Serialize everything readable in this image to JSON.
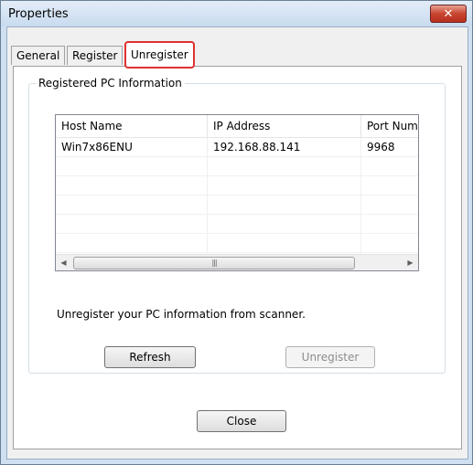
{
  "window": {
    "title": "Properties",
    "close_glyph": "✕"
  },
  "tabs": [
    {
      "label": "General"
    },
    {
      "label": "Register"
    },
    {
      "label": "Unregister"
    }
  ],
  "active_tab": "Unregister",
  "group": {
    "label": "Registered PC Information"
  },
  "table": {
    "columns": [
      "Host Name",
      "IP Address",
      "Port Numb"
    ],
    "rows": [
      [
        "Win7x86ENU",
        "192.168.88.141",
        "9968"
      ]
    ]
  },
  "scrollbar": {
    "left_arrow": "◀",
    "right_arrow": "▶",
    "grip": "|||"
  },
  "message": "Unregister your PC information from scanner.",
  "buttons": {
    "refresh": "Refresh",
    "unregister": "Unregister",
    "close": "Close"
  },
  "colors": {
    "active_tab_highlight": "#e03030",
    "close_button": "#c8452f"
  }
}
